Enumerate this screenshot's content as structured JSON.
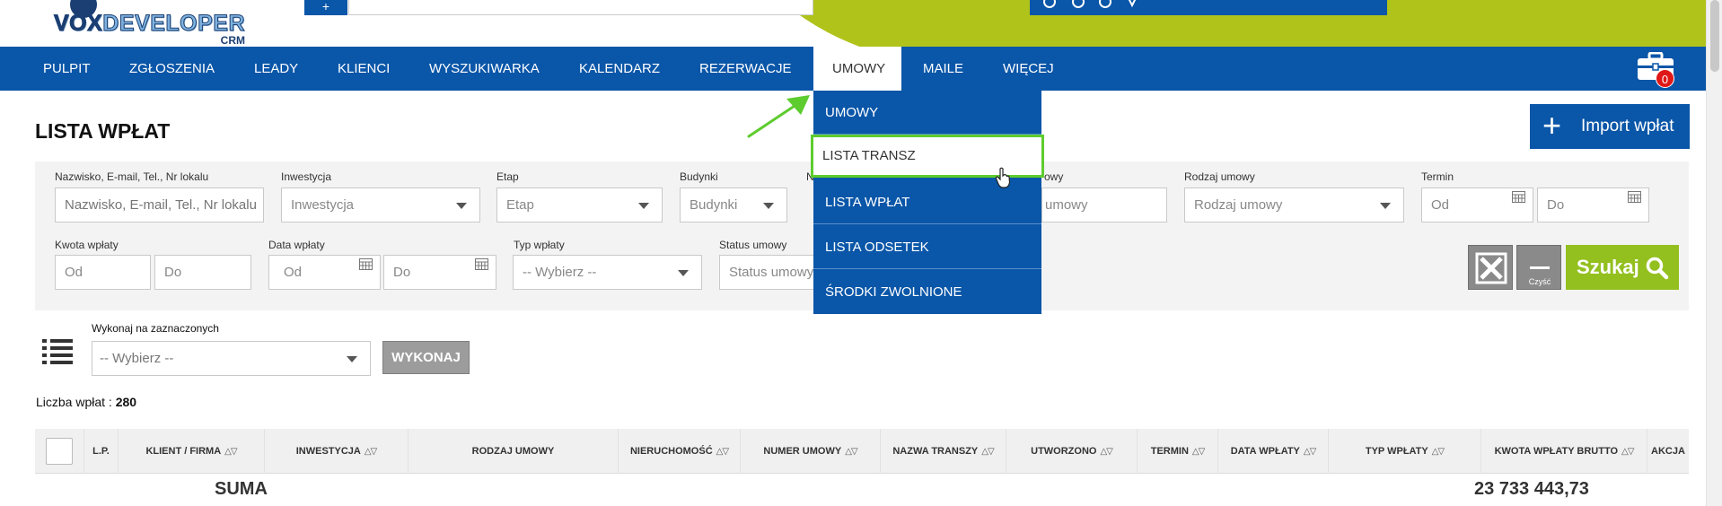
{
  "app": {
    "logo_main_a": "VOX",
    "logo_main_b": "DEVELOPER",
    "logo_sub": "CRM"
  },
  "colors": {
    "nav_blue": "#0a56a8",
    "accent_lime": "#b0c31b",
    "search_green": "#93c01f",
    "highlight_green": "#5dcc2e",
    "badge_red": "#e01717"
  },
  "nav": {
    "items": [
      "PULPIT",
      "ZGŁOSZENIA",
      "LEADY",
      "KLIENCI",
      "WYSZUKIWARKA",
      "KALENDARZ",
      "REZERWACJE",
      "UMOWY",
      "MAILE",
      "WIĘCEJ"
    ],
    "active": "UMOWY",
    "cart_count": "0"
  },
  "dropdown": {
    "items": [
      "UMOWY",
      "LISTA TRANSZ",
      "LISTA WPŁAT",
      "LISTA ODSETEK",
      "ŚRODKI ZWOLNIONE"
    ],
    "highlighted": "LISTA TRANSZ"
  },
  "page": {
    "title": "LISTA WPŁAT",
    "import_label": "Import wpłat"
  },
  "filters": {
    "search": {
      "label": "Nazwisko, E-mail, Tel., Nr lokalu",
      "placeholder": "Nazwisko, E-mail, Tel., Nr lokalu"
    },
    "investment": {
      "label": "Inwestycja",
      "value": "Inwestycja"
    },
    "stage": {
      "label": "Etap",
      "value": "Etap"
    },
    "buildings": {
      "label": "Budynki",
      "value": "Budynki"
    },
    "col5_label_partial": "N",
    "contract_no_label_partial": "owy",
    "contract_no_value_partial": "umowy",
    "contract_type": {
      "label": "Rodzaj umowy",
      "value": "Rodzaj umowy"
    },
    "term": {
      "label": "Termin",
      "from": "Od",
      "to": "Do"
    },
    "amount": {
      "label": "Kwota wpłaty",
      "from": "Od",
      "to": "Do"
    },
    "date": {
      "label": "Data wpłaty",
      "from": "Od",
      "to": "Do"
    },
    "payment_type": {
      "label": "Typ wpłaty",
      "value": "-- Wybierz --"
    },
    "contract_status": {
      "label": "Status umowy",
      "value": "Status umowy"
    },
    "clear_label": "Czyść",
    "search_label": "Szukaj"
  },
  "bulk": {
    "label": "Wykonaj na zaznaczonych",
    "select": "-- Wybierz --",
    "execute": "WYKONAJ"
  },
  "summary": {
    "count_label": "Liczba wpłat :",
    "count_value": "280",
    "sum_label": "SUMA",
    "sum_value": "23 733 443,73"
  },
  "table": {
    "columns": [
      "L.P.",
      "KLIENT / FIRMA",
      "INWESTYCJA",
      "RODZAJ UMOWY",
      "NIERUCHOMOŚĆ",
      "NUMER UMOWY",
      "NAZWA TRANSZY",
      "UTWORZONO",
      "TERMIN",
      "DATA WPŁATY",
      "TYP WPŁATY",
      "KWOTA WPŁATY BRUTTO",
      "AKCJA"
    ]
  }
}
